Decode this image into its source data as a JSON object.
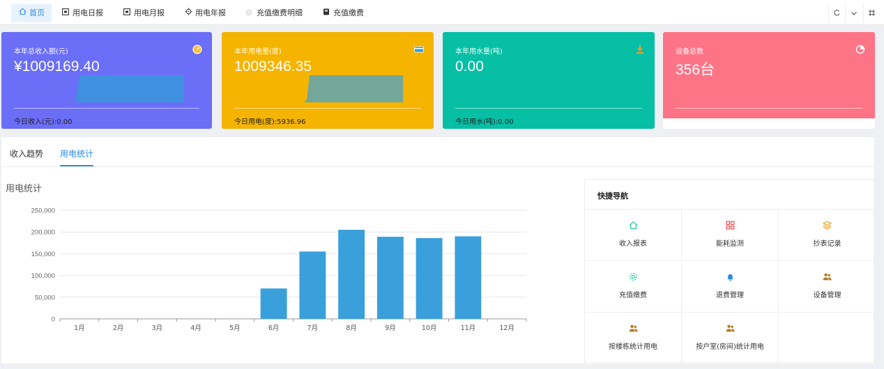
{
  "tabs": [
    {
      "label": "首页",
      "icon": "home-icon"
    },
    {
      "label": "用电日报",
      "icon": "calendar-day-icon"
    },
    {
      "label": "用电月报",
      "icon": "calendar-month-icon"
    },
    {
      "label": "用电年报",
      "icon": "target-icon"
    },
    {
      "label": "充值缴费明细",
      "icon": "dot-icon"
    },
    {
      "label": "充值缴费",
      "icon": "wallet-icon"
    }
  ],
  "toolbar": {
    "refresh_icon": "refresh-icon",
    "dropdown_icon": "chevron-down-icon",
    "fullscreen_icon": "fullscreen-icon"
  },
  "cards": [
    {
      "title": "本年总收入额(元)",
      "value": "¥1009169.40",
      "footer": "今日收入(元):0.00",
      "color": "#6b6ef7",
      "icon": "gauge-icon"
    },
    {
      "title": "本年用电量(度)",
      "value": "1009346.35",
      "footer": "今日用电(度):5936.96",
      "color": "#f5b400",
      "icon": "card-icon"
    },
    {
      "title": "本年用水量(吨)",
      "value": "0.00",
      "footer": "今日用水(吨):0.00",
      "color": "#07bfa5",
      "icon": "download-icon"
    },
    {
      "title": "设备总数",
      "value": "356台",
      "footer": "",
      "color": "#fd7487",
      "icon": "pie-icon"
    }
  ],
  "panel": {
    "tabs": [
      "收入趋势",
      "用电统计"
    ],
    "active_tab": 1,
    "chart_title": "用电统计"
  },
  "chart_data": {
    "type": "bar",
    "title": "用电统计",
    "categories": [
      "1月",
      "2月",
      "3月",
      "4月",
      "5月",
      "6月",
      "7月",
      "8月",
      "9月",
      "10月",
      "11月",
      "12月"
    ],
    "values": [
      0,
      0,
      0,
      0,
      0,
      70000,
      155000,
      205000,
      189000,
      186000,
      190000,
      0
    ],
    "y_ticks": [
      "0",
      "50,000",
      "100,000",
      "150,000",
      "200,000",
      "250,000"
    ],
    "ylim": [
      0,
      250000
    ],
    "color": "#3aa0dc",
    "grid": true
  },
  "quicknav": {
    "title": "快捷导航",
    "items": [
      {
        "label": "收入报表",
        "icon": "home-icon",
        "color": "#28c6a4"
      },
      {
        "label": "能耗监测",
        "icon": "grid-icon",
        "color": "#e8484b"
      },
      {
        "label": "抄表记录",
        "icon": "layers-icon",
        "color": "#f0a020"
      },
      {
        "label": "充值缴费",
        "icon": "gear-icon",
        "color": "#28c6a4"
      },
      {
        "label": "退费管理",
        "icon": "bell-icon",
        "color": "#2a8be6"
      },
      {
        "label": "设备管理",
        "icon": "users-icon",
        "color": "#b07a1e"
      },
      {
        "label": "按楼栋统计用电",
        "icon": "users-icon",
        "color": "#b07a1e"
      },
      {
        "label": "按户室(房间)统计用电",
        "icon": "users-icon",
        "color": "#b07a1e"
      }
    ]
  }
}
